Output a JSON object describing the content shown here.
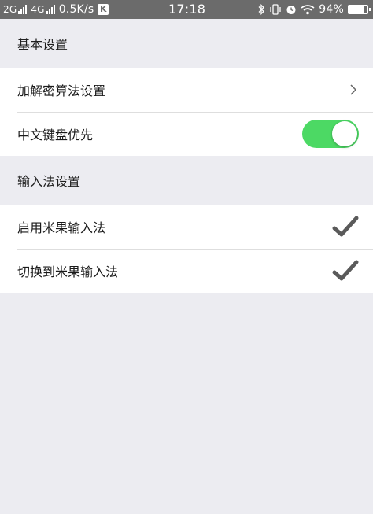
{
  "status_bar": {
    "sim1": "2G",
    "sim2": "4G",
    "speed": "0.5K/s",
    "k_badge": "K",
    "time": "17:18",
    "battery_percent": "94%",
    "battery_level": 0.94
  },
  "sections": [
    {
      "header": "基本设置",
      "rows": [
        {
          "label": "加解密算法设置",
          "control": "chevron"
        },
        {
          "label": "中文键盘优先",
          "control": "toggle",
          "on": true
        }
      ]
    },
    {
      "header": "输入法设置",
      "rows": [
        {
          "label": "启用米果输入法",
          "control": "check",
          "checked": true
        },
        {
          "label": "切换到米果输入法",
          "control": "check",
          "checked": true
        }
      ]
    }
  ],
  "colors": {
    "status_bar_bg": "#6b6b6b",
    "page_bg": "#ececf1",
    "toggle_on": "#4cd964",
    "check": "#5a5a5a"
  }
}
